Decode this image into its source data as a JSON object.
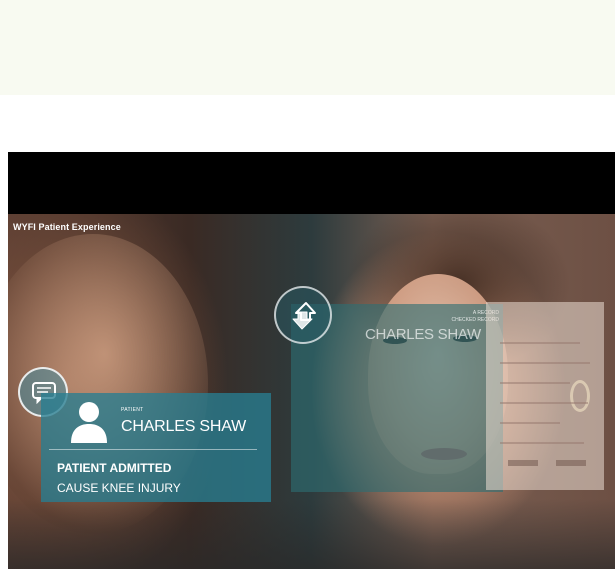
{
  "video": {
    "title": "WYFI Patient Experience"
  },
  "patient_card": {
    "label": "PATIENT",
    "name": "CHARLES SHAW",
    "status_bold": "PATIENT ADMITTED",
    "cause": "CAUSE KNEE INJURY"
  },
  "record_panel": {
    "caption_line1": "A RECORD",
    "caption_line2": "CHECKED RECORD",
    "name": "CHARLES SHAW"
  },
  "icons": {
    "message": "chat-bubble-icon",
    "person": "person-icon",
    "transfer": "transfer-arrows-icon"
  },
  "colors": {
    "card_teal": "#287d91",
    "top_band": "#f8faf1"
  }
}
